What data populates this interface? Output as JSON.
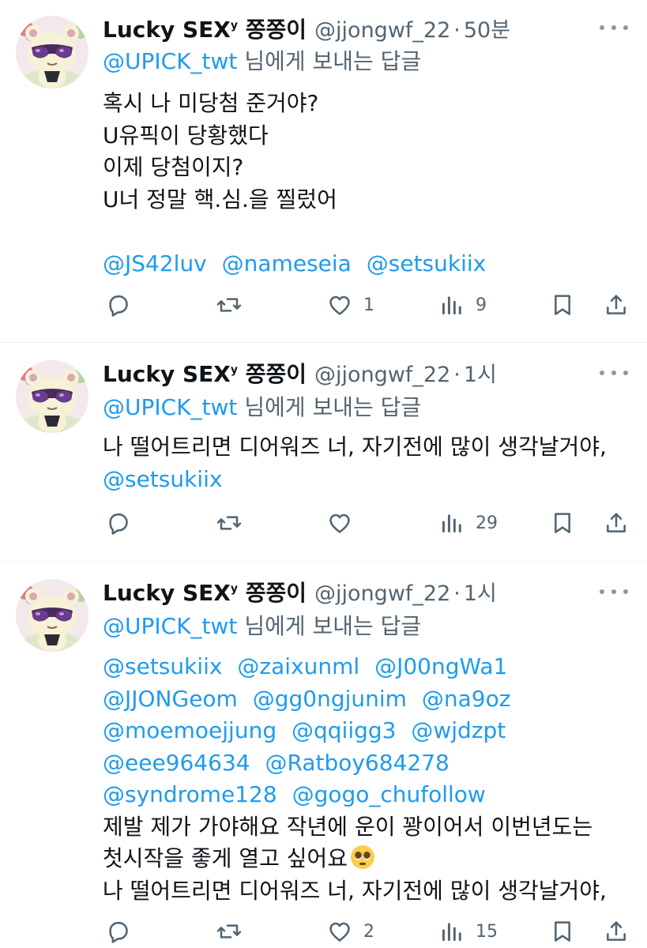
{
  "tweets": [
    {
      "display_name": "Lucky SEX",
      "name_super": "y",
      "name_suffix": "쫑쫑이",
      "handle": "@jjongwf_22",
      "separator": "·",
      "time": "50분",
      "replying_to_handle": "@UPICK_twt",
      "replying_to_suffix": "님에게 보내는 답글",
      "text_lines": [
        "혹시 나 미당첨 준거야?",
        "U유픽이 당황했다",
        "이제 당첨이지?",
        "U너 정말 핵.심.을 찔렀어"
      ],
      "mention_line": [
        "@JS42luv",
        "@nameseia",
        "@setsukiix"
      ],
      "stats": {
        "replies": "",
        "retweets": "",
        "likes": "1",
        "views": "9"
      }
    },
    {
      "display_name": "Lucky SEX",
      "name_super": "y",
      "name_suffix": "쫑쫑이",
      "handle": "@jjongwf_22",
      "separator": "·",
      "time": "1시",
      "replying_to_handle": "@UPICK_twt",
      "replying_to_suffix": "님에게 보내는 답글",
      "text_lines": [
        "나 떨어트리면 디어워즈 너, 자기전에 많이 생각날거야,"
      ],
      "mention_line": [
        "@setsukiix"
      ],
      "stats": {
        "replies": "",
        "retweets": "",
        "likes": "",
        "views": "29"
      }
    },
    {
      "display_name": "Lucky SEX",
      "name_super": "y",
      "name_suffix": "쫑쫑이",
      "handle": "@jjongwf_22",
      "separator": "·",
      "time": "1시",
      "replying_to_handle": "@UPICK_twt",
      "replying_to_suffix": "님에게 보내는 답글",
      "mention_lines": [
        [
          "@setsukiix",
          "@zaixunml",
          "@J00ngWa1"
        ],
        [
          "@JJONGeom",
          "@gg0ngjunim",
          "@na9oz"
        ],
        [
          "@moemoejjung",
          "@qqiigg3",
          "@wjdzpt"
        ],
        [
          "@eee964634",
          "@Ratboy684278"
        ],
        [
          "@syndrome128",
          "@gogo_chufollow"
        ]
      ],
      "text_lines": [
        "제발 제가 가야해요 작년에 운이 꽝이어서 이번년도는",
        "첫시작을 좋게 열고 싶어요",
        "나 떨어트리면 디어워즈 너, 자기전에 많이 생각날거야,"
      ],
      "emoji_name": "pleading-face-emoji",
      "stats": {
        "replies": "",
        "retweets": "",
        "likes": "2",
        "views": "15"
      }
    }
  ],
  "colors": {
    "text": "#0f1419",
    "secondary": "#536471",
    "link": "#1d9bf0",
    "divider": "#eff3f4"
  }
}
